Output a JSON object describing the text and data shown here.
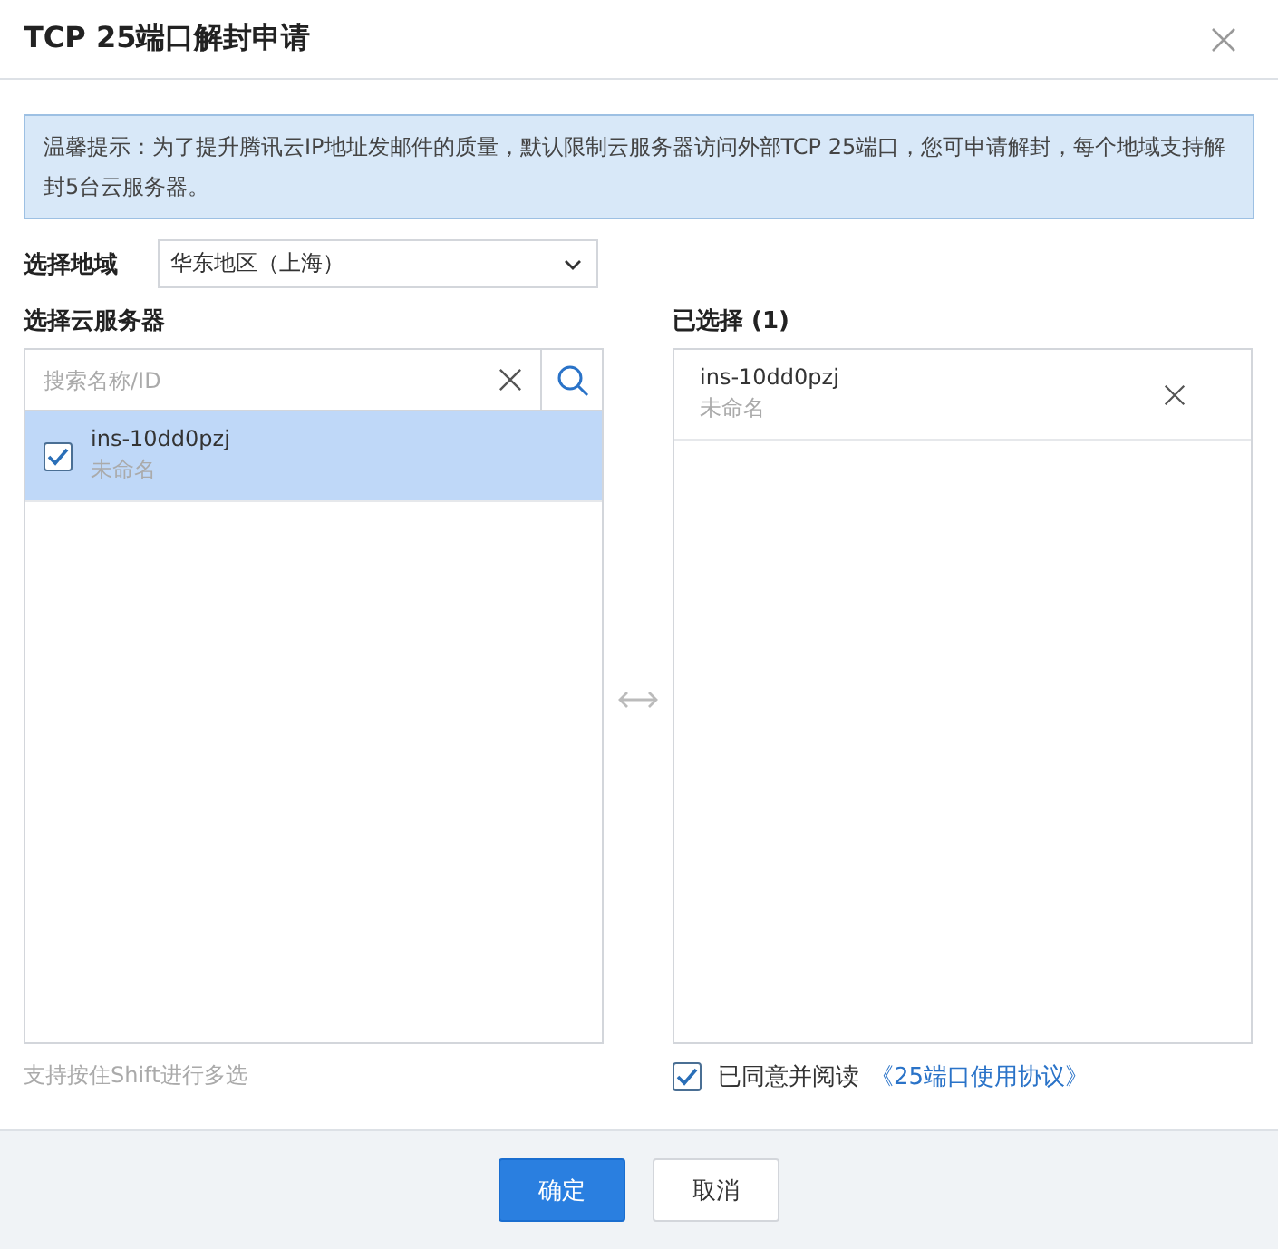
{
  "dialog": {
    "title": "TCP 25端口解封申请"
  },
  "notice": "温馨提示：为了提升腾讯云IP地址发邮件的质量，默认限制云服务器访问外部TCP 25端口，您可申请解封，每个地域支持解封5台云服务器。",
  "region": {
    "label": "选择地域",
    "value": "华东地区（上海）"
  },
  "source": {
    "label": "选择云服务器",
    "search_placeholder": "搜索名称/ID",
    "items": [
      {
        "id": "ins-10dd0pzj",
        "name": "未命名",
        "checked": true,
        "selected": true
      }
    ],
    "hint": "支持按住Shift进行多选"
  },
  "target": {
    "label": "已选择 (1)",
    "items": [
      {
        "id": "ins-10dd0pzj",
        "name": "未命名"
      }
    ]
  },
  "agreement": {
    "checked": true,
    "text": "已同意并阅读",
    "link": "《25端口使用协议》"
  },
  "buttons": [
    {
      "label": "确定",
      "kind": "primary"
    },
    {
      "label": "取消",
      "kind": "default"
    }
  ]
}
